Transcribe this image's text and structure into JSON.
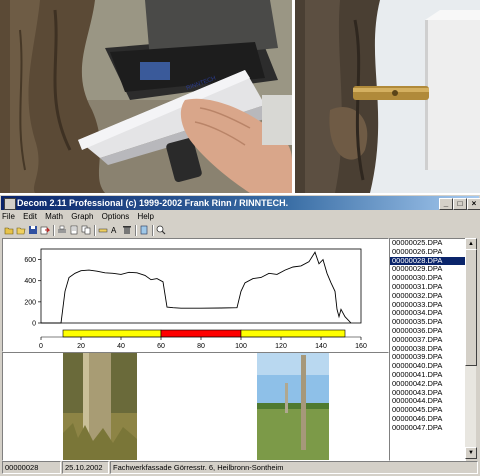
{
  "window": {
    "title": "Decom 2.11 Professional  (c) 1999-2002 Frank Rinn / RINNTECH.",
    "btn_min": "_",
    "btn_max": "□",
    "btn_close": "×"
  },
  "photos": {
    "device_brand": "RINNTECH"
  },
  "menu": [
    "File",
    "Edit",
    "Math",
    "Graph",
    "Options",
    "Help"
  ],
  "toolbar_icons": [
    "open-icon",
    "folder-icon",
    "save-icon",
    "export-icon",
    "print-icon",
    "print-preview-icon",
    "copy-icon",
    "paste-icon",
    "measure-icon",
    "text-icon",
    "delete-icon",
    "info-icon",
    "zoom-icon"
  ],
  "files": {
    "items": [
      "00000025.DPA",
      "00000026.DPA",
      "00000028.DPA",
      "00000029.DPA",
      "00000030.DPA",
      "00000031.DPA",
      "00000032.DPA",
      "00000033.DPA",
      "00000034.DPA",
      "00000035.DPA",
      "00000036.DPA",
      "00000037.DPA",
      "00000038.DPA",
      "00000039.DPA",
      "00000040.DPA",
      "00000041.DPA",
      "00000042.DPA",
      "00000043.DPA",
      "00000044.DPA",
      "00000045.DPA",
      "00000046.DPA",
      "00000047.DPA"
    ],
    "selected_index": 2
  },
  "status": {
    "file_id": "00000028",
    "date": "25.10.2002",
    "location": "Fachwerkfassade Görresstr. 6, Heilbronn-Sontheim"
  },
  "colors": {
    "title_bar": "#0a246a",
    "selection": "#0a246a",
    "band_yellow": "#ffff00",
    "band_red": "#ff0000"
  },
  "chart_data": {
    "type": "line",
    "title": "",
    "xlabel": "",
    "ylabel": "",
    "xlim": [
      0,
      160
    ],
    "ylim": [
      0,
      700
    ],
    "xticks": [
      0,
      20,
      40,
      60,
      80,
      100,
      120,
      140,
      160
    ],
    "yticks": [
      0,
      200,
      400,
      600
    ],
    "x": [
      0,
      10,
      12,
      14,
      17,
      20,
      24,
      28,
      32,
      36,
      40,
      44,
      48,
      52,
      55,
      58,
      61,
      63,
      66,
      70,
      80,
      90,
      98,
      100,
      102,
      106,
      110,
      114,
      118,
      122,
      126,
      130,
      134,
      137,
      139,
      141,
      143,
      145,
      147,
      148,
      149,
      150,
      152,
      155
    ],
    "y": [
      0,
      0,
      300,
      430,
      470,
      495,
      500,
      490,
      475,
      470,
      460,
      480,
      475,
      450,
      410,
      420,
      390,
      150,
      145,
      140,
      140,
      142,
      145,
      300,
      380,
      420,
      430,
      470,
      460,
      500,
      530,
      540,
      580,
      670,
      560,
      600,
      470,
      380,
      300,
      130,
      60,
      130,
      60,
      0
    ],
    "bands": [
      {
        "from": 11,
        "to": 60,
        "color": "yellow"
      },
      {
        "from": 60,
        "to": 100,
        "color": "red"
      },
      {
        "from": 100,
        "to": 152,
        "color": "yellow"
      }
    ],
    "grid": false
  }
}
